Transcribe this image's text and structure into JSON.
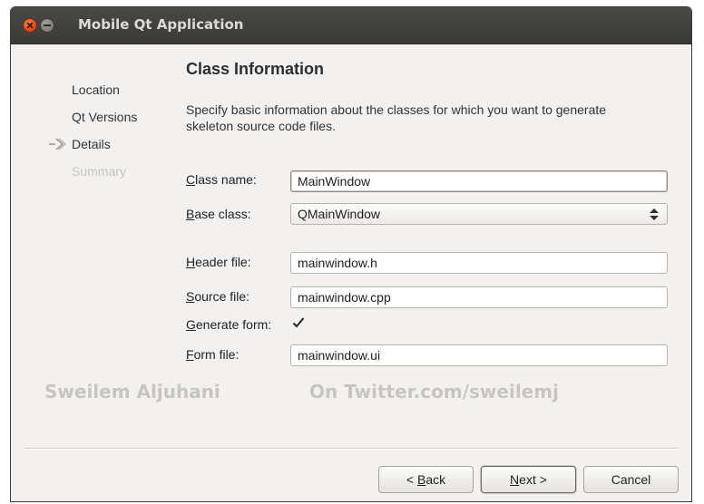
{
  "window": {
    "title": "Mobile Qt Application"
  },
  "steps": [
    {
      "label": "Location",
      "state": "done"
    },
    {
      "label": "Qt Versions",
      "state": "done"
    },
    {
      "label": "Details",
      "state": "current"
    },
    {
      "label": "Summary",
      "state": "disabled"
    }
  ],
  "page": {
    "title": "Class Information",
    "description": "Specify basic information about the classes for which you want to generate skeleton source code files."
  },
  "form": {
    "class_name": {
      "label": "Class name:",
      "accel": "C",
      "value": "MainWindow"
    },
    "base_class": {
      "label": "Base class:",
      "accel": "B",
      "value": "QMainWindow"
    },
    "header_file": {
      "label": "Header file:",
      "accel": "H",
      "value": "mainwindow.h"
    },
    "source_file": {
      "label": "Source file:",
      "accel": "S",
      "value": "mainwindow.cpp"
    },
    "generate_form": {
      "label": "Generate form:",
      "accel": "G",
      "checked": true
    },
    "form_file": {
      "label": "Form file:",
      "accel": "F",
      "value": "mainwindow.ui"
    }
  },
  "watermark": {
    "left": "Sweilem Aljuhani",
    "right": "On Twitter.com/sweilemj"
  },
  "buttons": {
    "back": {
      "accel": "B",
      "rest": "ack",
      "prefix": "< "
    },
    "next": {
      "accel": "N",
      "rest": "ext",
      "suffix": " >"
    },
    "cancel": "Cancel"
  },
  "colors": {
    "titlebar": "#3c3b37",
    "close_button": "#df4a16",
    "window_bg": "#f2f1f0"
  }
}
